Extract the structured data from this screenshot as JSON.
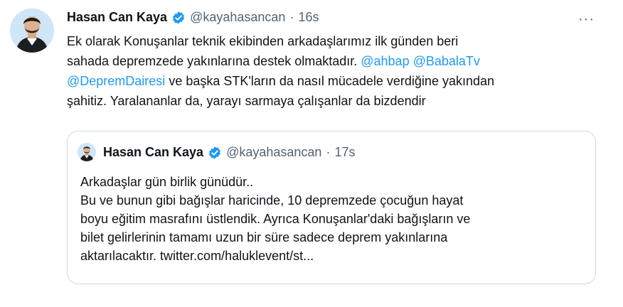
{
  "tweet": {
    "author_name": "Hasan Can Kaya",
    "handle": "@kayahasancan",
    "separator": "·",
    "time": "16s",
    "more_glyph": "···",
    "body": {
      "line1": "Ek olarak Konuşanlar teknik ekibinden arkadaşlarımız ilk günden beri",
      "line2_text": "sahada depremzede yakınlarına destek olmaktadır. ",
      "mention_ahbap": "@ahbap",
      "mention_babala": "@BabalaTv",
      "mention_deprem": "@DepremDairesi",
      "line3_rest": " ve başka STK'ların da nasıl mücadele verdiğine yakından",
      "line4": "şahitiz. Yaralananlar da, yarayı sarmaya çalışanlar da bizdendir"
    }
  },
  "quoted": {
    "author_name": "Hasan Can Kaya",
    "handle": "@kayahasancan",
    "separator": "·",
    "time": "17s",
    "line1": "Arkadaşlar gün birlik günüdür..",
    "line2": "Bu ve bunun gibi bağışlar haricinde, 10 depremzede çocuğun hayat",
    "line3": "boyu eğitim masrafını üstlendik. Ayrıca Konuşanlar'daki bağışların ve",
    "line4": "bilet gelirlerinin tamamı uzun bir süre sadece deprem yakınlarına",
    "line5": "aktarılacaktır. twitter.com/haluklevent/st..."
  },
  "icons": {
    "avatar": "avatar-photo",
    "verified": "verified-badge-icon",
    "more": "more-icon"
  },
  "colors": {
    "accent": "#1d9bf0",
    "text": "#0f1419",
    "muted": "#536471",
    "border": "#cfd9de"
  }
}
